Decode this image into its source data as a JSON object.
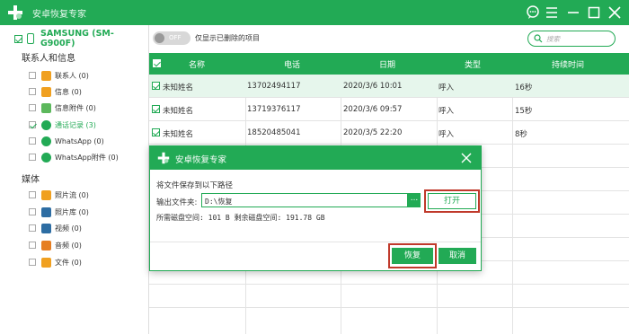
{
  "window": {
    "title": "安卓恢复专家"
  },
  "device": {
    "name": "SAMSUNG (SM-G900F)"
  },
  "sidebar": {
    "group1": "联系人和信息",
    "items1": [
      {
        "label": "联系人 (0)",
        "icon": "contacts-icon",
        "color": "#f0a020"
      },
      {
        "label": "信息 (0)",
        "icon": "messages-icon",
        "color": "#f0a020"
      },
      {
        "label": "信息附件 (0)",
        "icon": "attachment-icon",
        "color": "#5cb85c"
      },
      {
        "label": "通话记录 (3)",
        "icon": "call-log-icon",
        "color": "#22aa55"
      },
      {
        "label": "WhatsApp (0)",
        "icon": "whatsapp-icon",
        "color": "#22aa55"
      },
      {
        "label": "WhatsApp附件 (0)",
        "icon": "whatsapp-attachment-icon",
        "color": "#22aa55"
      }
    ],
    "group2": "媒体",
    "items2": [
      {
        "label": "照片流 (0)",
        "icon": "photo-stream-icon",
        "color": "#f0a020"
      },
      {
        "label": "照片库 (0)",
        "icon": "photo-library-icon",
        "color": "#2d6da3"
      },
      {
        "label": "视频 (0)",
        "icon": "video-icon",
        "color": "#2d6da3"
      },
      {
        "label": "音频 (0)",
        "icon": "audio-icon",
        "color": "#e67e22"
      },
      {
        "label": "文件 (0)",
        "icon": "folder-icon",
        "color": "#f0a020"
      }
    ]
  },
  "toolbar": {
    "toggle_text": "OFF",
    "toggle_label": "仅显示已删除的项目",
    "search_placeholder": "搜索"
  },
  "table": {
    "headers": [
      "名称",
      "电话",
      "日期",
      "类型",
      "持续时间"
    ],
    "rows": [
      {
        "name": "未知姓名",
        "phone": "13702494117",
        "date": "2020/3/6 10:01",
        "type": "呼入",
        "duration": "16秒"
      },
      {
        "name": "未知姓名",
        "phone": "13719376117",
        "date": "2020/3/6 09:57",
        "type": "呼入",
        "duration": "15秒"
      },
      {
        "name": "未知姓名",
        "phone": "18520485041",
        "date": "2020/3/5 22:20",
        "type": "呼入",
        "duration": "8秒"
      }
    ]
  },
  "dialog": {
    "title": "安卓恢复专家",
    "prompt": "将文件保存到以下路径",
    "folder_label": "输出文件夹:",
    "folder_value": "D:\\恢复",
    "browse_label": "...",
    "open_label": "打开",
    "space_text": "所需磁盘空间:  101 B  剩余磁盘空间:  191.78 GB",
    "recover_label": "恢复",
    "cancel_label": "取消"
  },
  "colors": {
    "accent": "#22aa55",
    "highlight": "#c0392b"
  }
}
